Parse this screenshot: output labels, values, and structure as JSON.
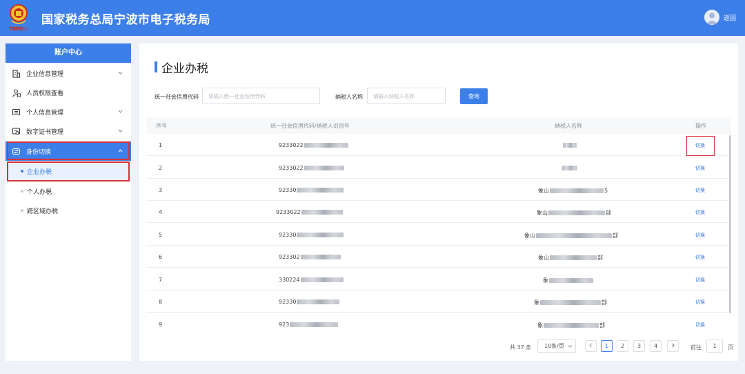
{
  "header": {
    "emblem_caption": "宁波税务",
    "title": "国家税务总局宁波市电子税务局",
    "back_label": "返回"
  },
  "sidebar": {
    "title": "账户中心",
    "items": [
      {
        "label": "企业信息管理",
        "icon": "building-icon",
        "expandable": true
      },
      {
        "label": "人员权限查看",
        "icon": "user-lock-icon",
        "expandable": false
      },
      {
        "label": "个人信息管理",
        "icon": "id-card-icon",
        "expandable": true
      },
      {
        "label": "数字证书管理",
        "icon": "certificate-icon",
        "expandable": true
      },
      {
        "label": "身份切换",
        "icon": "swap-icon",
        "expandable": true,
        "expanded": true
      }
    ],
    "sub_items": [
      {
        "label": "企业办税",
        "selected": true
      },
      {
        "label": "个人办税"
      },
      {
        "label": "跨区域办税"
      }
    ]
  },
  "main": {
    "title": "企业办税",
    "filters": {
      "credit_code_label": "统一社会信用代码",
      "credit_code_placeholder": "请输入统一社会信用代码",
      "credit_code_value": "",
      "taxpayer_name_label": "纳税人名称",
      "taxpayer_name_placeholder": "请输入纳税人名称",
      "taxpayer_name_value": "",
      "query_label": "查询"
    },
    "table": {
      "headers": [
        "序号",
        "统一社会信用代码/纳税人识别号",
        "纳税人名称",
        "操作"
      ],
      "rows": [
        {
          "index": "1",
          "code_visible": "9233022",
          "name_visible": "",
          "action": "切换"
        },
        {
          "index": "2",
          "code_visible": "9233022",
          "name_visible": "",
          "action": "切换"
        },
        {
          "index": "3",
          "code_visible": "92330",
          "name_prefix": "象山",
          "name_suffix": "5",
          "action": "切换"
        },
        {
          "index": "4",
          "code_visible": "9233022",
          "name_prefix": "象山",
          "name_suffix": "部",
          "action": "切换"
        },
        {
          "index": "5",
          "code_visible": "92330",
          "name_prefix": "象山",
          "name_suffix": "部",
          "action": "切换"
        },
        {
          "index": "6",
          "code_visible": "923302",
          "name_prefix": "象山",
          "name_suffix": "部",
          "action": "切换"
        },
        {
          "index": "7",
          "code_visible": "330224",
          "name_prefix": "象",
          "name_suffix": "",
          "action": "切换"
        },
        {
          "index": "8",
          "code_visible": "92330",
          "name_prefix": "象",
          "name_suffix": "部",
          "action": "切换"
        },
        {
          "index": "9",
          "code_visible": "923",
          "name_prefix": "象",
          "name_suffix": "部",
          "action": "切换"
        }
      ]
    },
    "pagination": {
      "total_text": "共 37 条",
      "page_size": "10条/页",
      "pages": [
        "1",
        "2",
        "3",
        "4"
      ],
      "current_page": "1",
      "goto_label": "前往",
      "goto_value": "1",
      "page_unit": "页"
    }
  },
  "colors": {
    "primary": "#3d7fe8",
    "highlight_border": "#d9303a",
    "page_background": "#eef1f6"
  }
}
